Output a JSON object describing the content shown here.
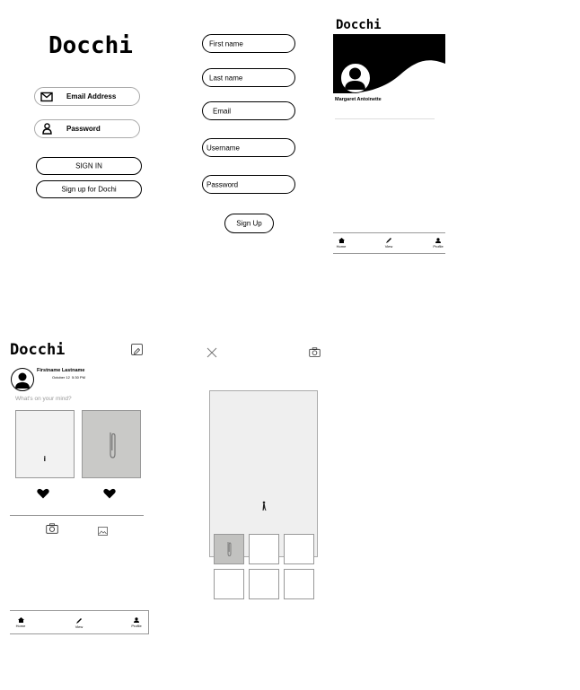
{
  "app": {
    "name": "Docchi"
  },
  "login": {
    "title": "Docchi",
    "email_label": "Email Address",
    "password_label": "Password",
    "signin_label": "SIGN IN",
    "signup_label": "Sign up for Dochi"
  },
  "signup": {
    "first_name": "First name",
    "last_name": "Last name",
    "email": "Email",
    "username": "Username",
    "password": "Password",
    "submit_label": "Sign Up"
  },
  "profile": {
    "title": "Docchi",
    "user_name": "Margaret Antoinette",
    "nav": {
      "home": "Home",
      "view": "View",
      "profile": "Profile"
    }
  },
  "feed": {
    "title": "Docchi",
    "author": "Firstname Lastname",
    "timestamp": "October 12  5:30 PM",
    "prompt": "What's on your mind?",
    "nav": {
      "home": "Home",
      "view": "View",
      "profile": "Profile"
    }
  },
  "colors": {
    "ink": "#000000",
    "border_grey": "#999999",
    "photo_bg": "#f2f2f2"
  },
  "icons": [
    "email-icon",
    "person-icon",
    "edit-icon",
    "heart-icon",
    "camera-icon",
    "image-icon",
    "home-icon",
    "pencil-icon",
    "profile-icon",
    "close-icon"
  ]
}
